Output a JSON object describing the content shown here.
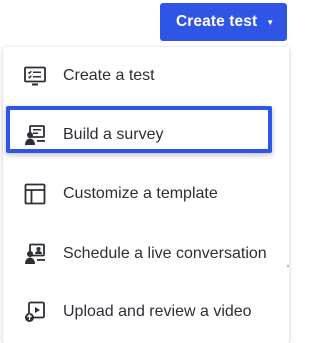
{
  "header": {
    "create_button_label": "Create test",
    "caret_glyph": "▼"
  },
  "menu": {
    "items": [
      {
        "label": "Create a test",
        "icon": "test-screen-icon"
      },
      {
        "label": "Build a survey",
        "icon": "survey-presenter-icon"
      },
      {
        "label": "Customize a template",
        "icon": "template-layout-icon"
      },
      {
        "label": "Schedule a live conversation",
        "icon": "live-conversation-icon"
      },
      {
        "label": "Upload and review a video",
        "icon": "video-upload-icon"
      }
    ],
    "highlighted_index": 1
  },
  "colors": {
    "accent": "#2f55e6",
    "text": "#2b2f36",
    "icon": "#2b2f36"
  }
}
